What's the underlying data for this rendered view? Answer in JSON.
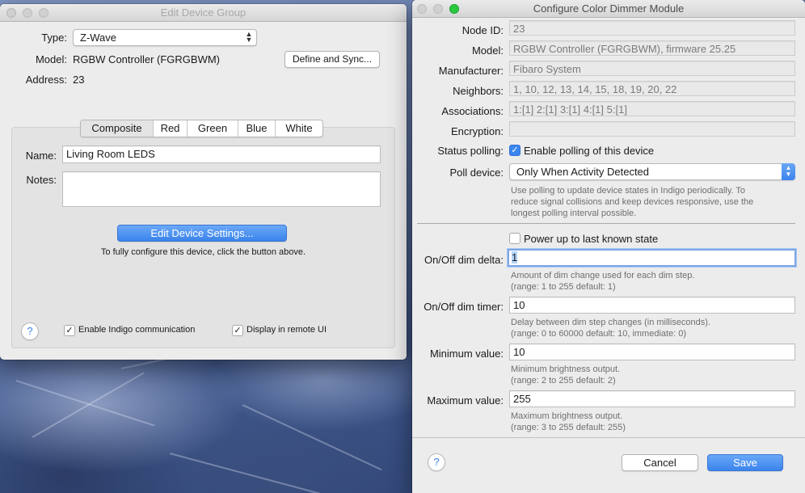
{
  "left_window": {
    "title": "Edit Device Group",
    "type_label": "Type:",
    "type_value": "Z-Wave",
    "model_label": "Model:",
    "model_value": "RGBW Controller (FGRGBWM)",
    "define_sync_button": "Define and Sync...",
    "address_label": "Address:",
    "address_value": "23",
    "tabs": [
      "Composite",
      "Red",
      "Green",
      "Blue",
      "White"
    ],
    "selected_tab": "Composite",
    "name_label": "Name:",
    "name_value": "Living Room LEDS",
    "notes_label": "Notes:",
    "notes_value": "",
    "edit_settings_button": "Edit Device Settings...",
    "edit_settings_hint": "To fully configure this device, click the button above.",
    "help_glyph": "?",
    "enable_comm_label": "Enable Indigo communication",
    "enable_comm_checked": true,
    "display_remote_label": "Display in remote UI",
    "display_remote_checked": true
  },
  "right_window": {
    "title": "Configure Color Dimmer Module",
    "node_id_label": "Node ID:",
    "node_id_value": "23",
    "model_label": "Model:",
    "model_value": "RGBW Controller (FGRGBWM), firmware 25.25",
    "manufacturer_label": "Manufacturer:",
    "manufacturer_value": "Fibaro System",
    "neighbors_label": "Neighbors:",
    "neighbors_value": "1, 10, 12, 13, 14, 15, 18, 19, 20, 22",
    "associations_label": "Associations:",
    "associations_value": "1:[1] 2:[1] 3:[1] 4:[1] 5:[1]",
    "encryption_label": "Encryption:",
    "encryption_value": "",
    "status_polling_label": "Status polling:",
    "status_polling_checkbox_label": "Enable polling of this device",
    "status_polling_checked": true,
    "poll_device_label": "Poll device:",
    "poll_device_value": "Only When Activity Detected",
    "poll_help_1": "Use polling to update device states in Indigo periodically. To",
    "poll_help_2": "reduce signal collisions and keep devices responsive, use the",
    "poll_help_3": "longest polling interval possible.",
    "power_up_label": "Power up to last known state",
    "power_up_checked": false,
    "dim_delta_label": "On/Off dim delta:",
    "dim_delta_value": "1",
    "dim_delta_help_1": "Amount of dim change used for each dim step.",
    "dim_delta_help_2": "(range: 1 to 255   default: 1)",
    "dim_timer_label": "On/Off dim timer:",
    "dim_timer_value": "10",
    "dim_timer_help_1": "Delay between dim step changes (in milliseconds).",
    "dim_timer_help_2": "(range: 0 to 60000   default: 10, immediate: 0)",
    "min_value_label": "Minimum value:",
    "min_value_value": "10",
    "min_value_help_1": "Minimum brightness output.",
    "min_value_help_2": "(range: 2 to 255   default: 2)",
    "max_value_label": "Maximum value:",
    "max_value_value": "255",
    "max_value_help_1": "Maximum brightness output.",
    "max_value_help_2": "(range: 3 to 255   default: 255)",
    "help_glyph": "?",
    "cancel_button": "Cancel",
    "save_button": "Save"
  },
  "glyphs": {
    "checkmark": "✓",
    "up_arrow": "▲",
    "down_arrow": "▼"
  },
  "colors": {
    "accent_blue": "#3b83ec",
    "window_bg": "#ececec",
    "traffic_green": "#2bc840"
  }
}
